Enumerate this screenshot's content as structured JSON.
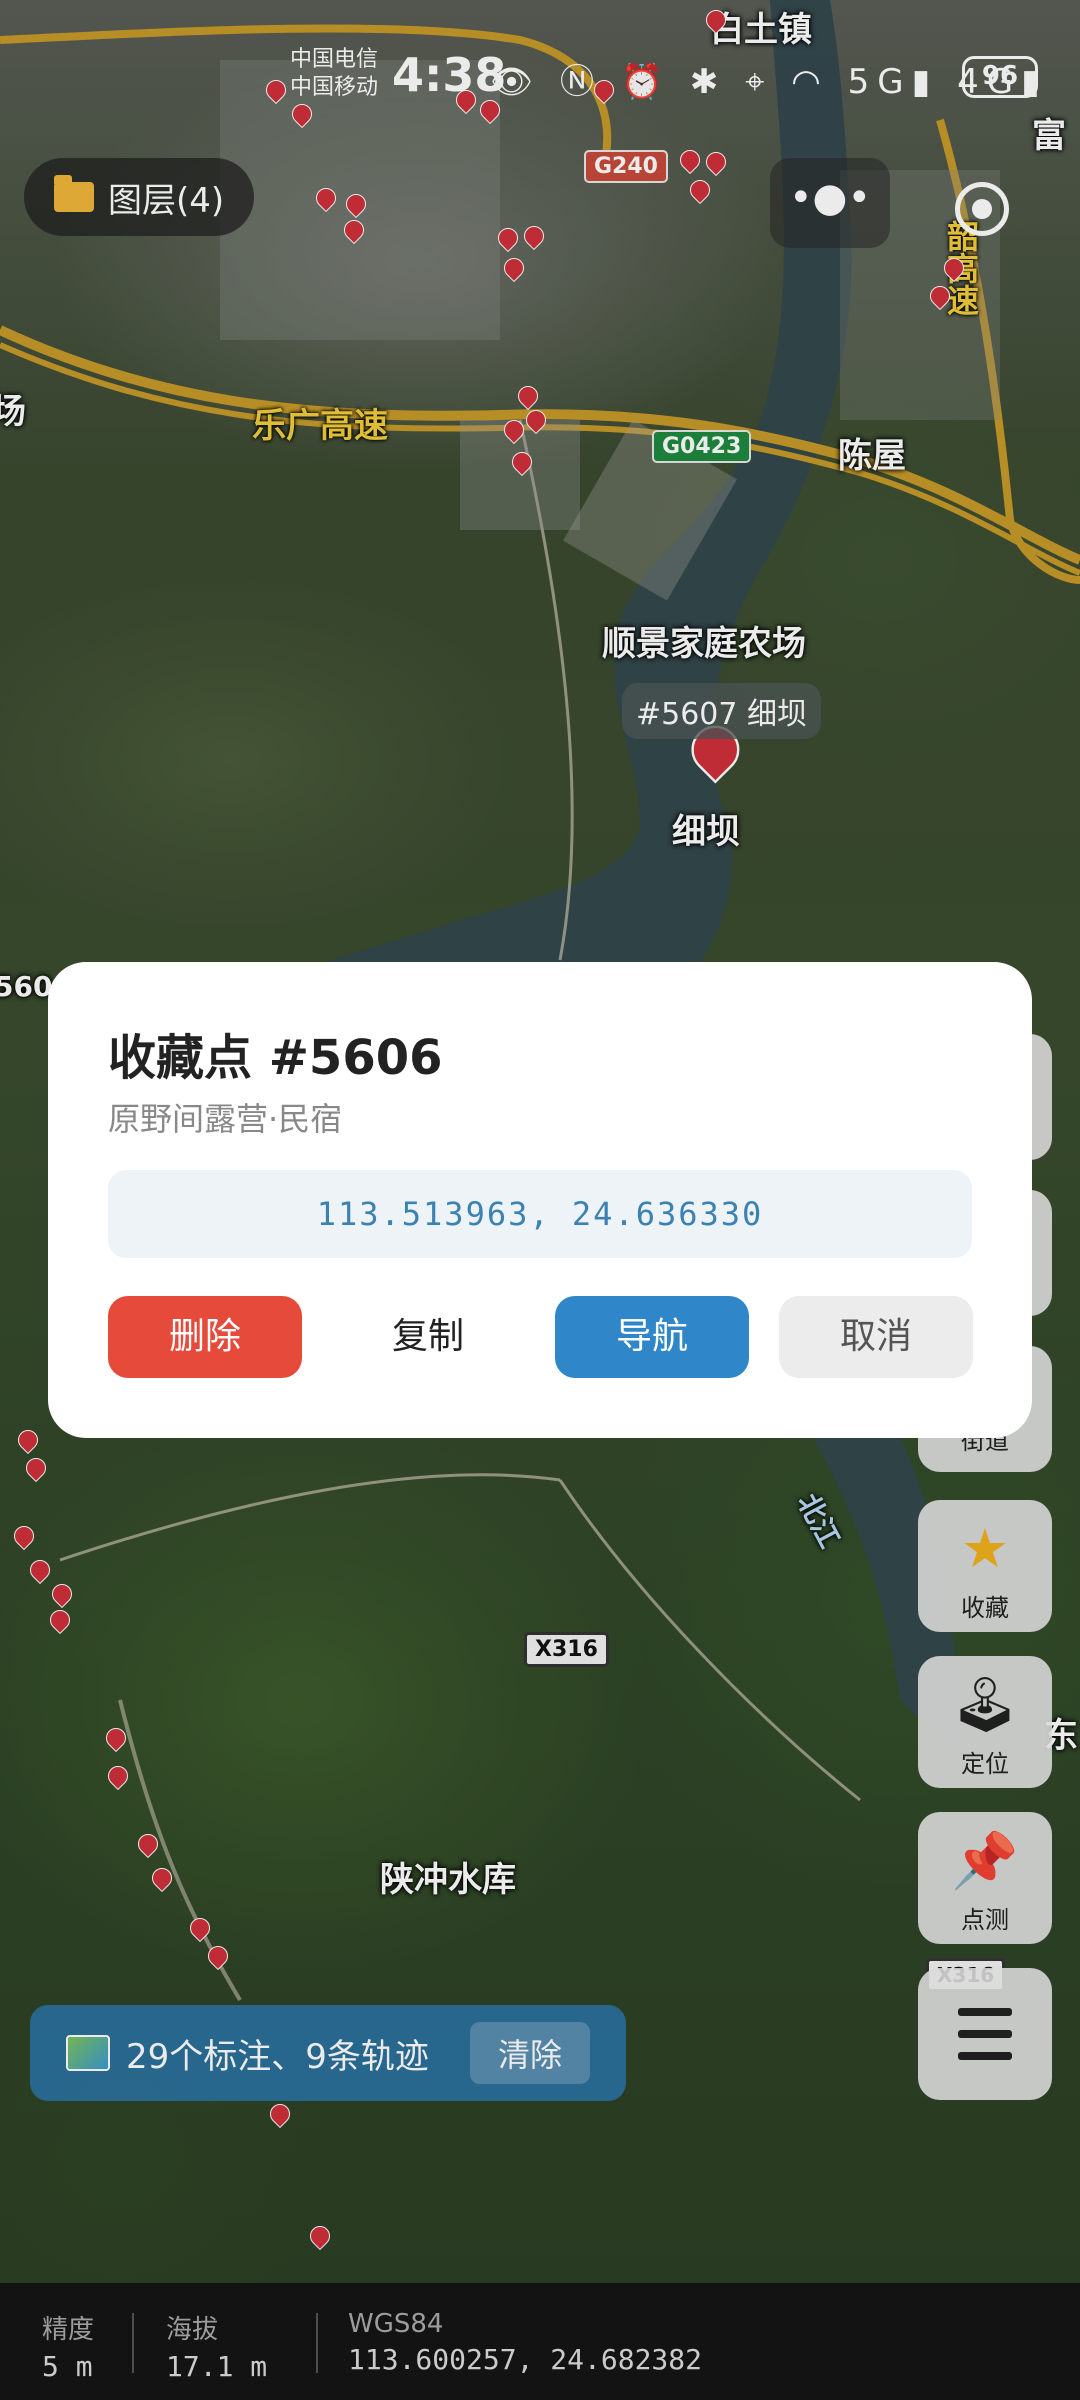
{
  "status_bar": {
    "carrier1": "中国电信",
    "carrier2": "中国移动",
    "time": "4:38",
    "icons": "👁 Ⓝ ⏰ ✱ ⌖ ◠ 5G▮ 4G▮",
    "battery": "96"
  },
  "top": {
    "layers_label": "图层(4)",
    "more_label": "•●•"
  },
  "map": {
    "labels": {
      "town_top": "白土镇",
      "highway_lg": "乐广高速",
      "highway_sz": "韶高速",
      "highway_sz_prefix": "",
      "village_chenwu": "陈屋",
      "farm": "顺景家庭农场",
      "xiba": "细坝",
      "reservoir": "陕冲水库",
      "river": "北江",
      "edge_left": "场",
      "edge_right_top": "富",
      "edge_right_mid": "东",
      "left_clip": "560"
    },
    "shields": {
      "g240": "G240",
      "g0423": "G0423",
      "x316": "X316",
      "x316_b": "X316"
    },
    "selected_pin_tag": "#5607 细坝"
  },
  "side_buttons": [
    {
      "label": "收藏",
      "icon": "star-icon"
    },
    {
      "label": "定位",
      "icon": "joystick-icon"
    },
    {
      "label": "点测",
      "icon": "pushpin-icon"
    },
    {
      "label": "街道",
      "icon": ""
    }
  ],
  "summary": {
    "text": "29个标注、9条轨迹",
    "clear_label": "清除"
  },
  "info_bar": {
    "accuracy_label": "精度",
    "accuracy_value": "5 m",
    "altitude_label": "海拔",
    "altitude_value": "17.1 m",
    "datum_label": "WGS84",
    "coords_value": "113.600257, 24.682382"
  },
  "dialog": {
    "title": "收藏点 #5606",
    "subtitle": "原野间露营·民宿",
    "coords": "113.513963, 24.636330",
    "delete_label": "删除",
    "copy_label": "复制",
    "navigate_label": "导航",
    "cancel_label": "取消"
  },
  "colors": {
    "delete": "#e64a3b",
    "navigate": "#2f86c8",
    "summary_bg": "#2d78af",
    "pin": "#d0303a"
  }
}
